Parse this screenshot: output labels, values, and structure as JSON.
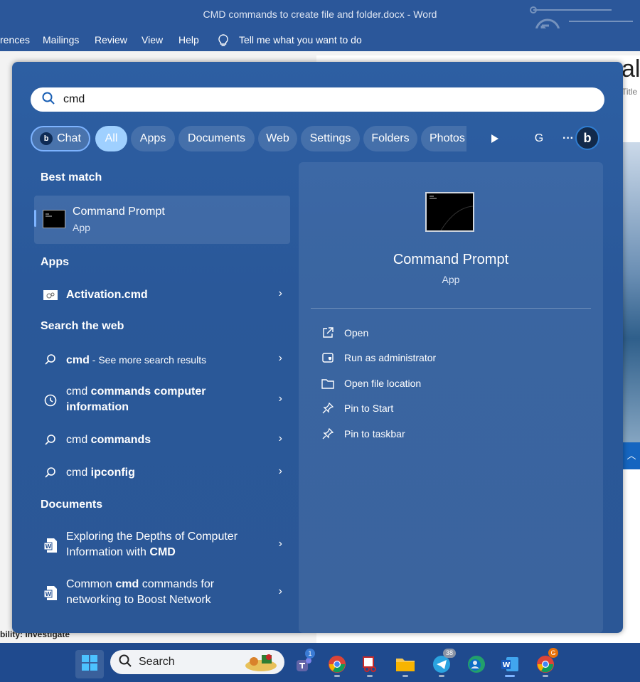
{
  "word": {
    "window_title": "CMD commands to create file and folder.docx  -  Word",
    "ribbon": [
      "rences",
      "Mailings",
      "Review",
      "View",
      "Help"
    ],
    "tell_me": "Tell me what you want to do",
    "style_preview_letters": "al",
    "style_name": "Title",
    "status_text": "bility: Investigate"
  },
  "search": {
    "query": "cmd"
  },
  "filters": {
    "chat": "Chat",
    "items": [
      "All",
      "Apps",
      "Documents",
      "Web",
      "Settings",
      "Folders",
      "Photos"
    ],
    "active": "All",
    "play_icon": "play-icon",
    "account_initial": "G",
    "more": "···",
    "bing_logo": "b"
  },
  "results": {
    "best_match_heading": "Best match",
    "best_match": {
      "name": "Command Prompt",
      "type": "App"
    },
    "apps_heading": "Apps",
    "apps": [
      {
        "label": "Activation.cmd"
      }
    ],
    "web_heading": "Search the web",
    "web": [
      {
        "bold": "cmd",
        "rest": " - See more search results",
        "icon": "search-icon"
      },
      {
        "line1_normal": "cmd ",
        "line1_bold": "commands computer",
        "line2": "information",
        "icon": "history-icon"
      },
      {
        "normal": "cmd ",
        "bold": "commands",
        "icon": "search-icon"
      },
      {
        "normal": "cmd ",
        "bold": "ipconfig",
        "icon": "search-icon"
      }
    ],
    "documents_heading": "Documents",
    "documents": [
      {
        "line1": "Exploring the Depths of Computer",
        "line2_normal": "Information with ",
        "line2_bold": "CMD"
      },
      {
        "line1_normal": "Common ",
        "line1_bold": "cmd",
        "line1_rest": " commands for",
        "line2": "networking to Boost Network"
      }
    ]
  },
  "preview": {
    "name": "Command Prompt",
    "type": "App",
    "actions": [
      "Open",
      "Run as administrator",
      "Open file location",
      "Pin to Start",
      "Pin to taskbar"
    ]
  },
  "taskbar": {
    "search_label": "Search",
    "teams_badge": "1",
    "telegram_badge": "38",
    "chrome_badge": "G"
  },
  "colors": {
    "word_blue": "#2b579a",
    "panel_blue": "#2a5899",
    "accent": "#7db3ff",
    "active_chip": "#9fd0ff"
  }
}
